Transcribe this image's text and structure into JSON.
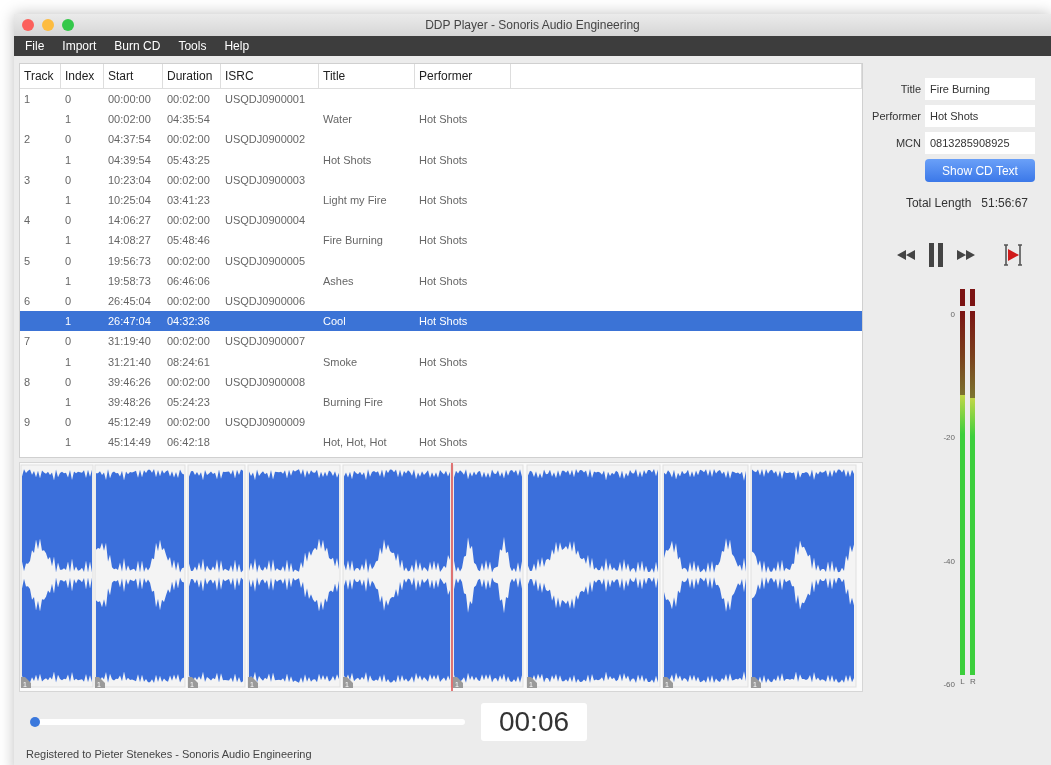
{
  "window": {
    "title": "DDP Player - Sonoris Audio Engineering"
  },
  "menu": [
    "File",
    "Import",
    "Burn CD",
    "Tools",
    "Help"
  ],
  "table": {
    "columns": [
      "Track",
      "Index",
      "Start",
      "Duration",
      "ISRC",
      "Title",
      "Performer"
    ],
    "rows": [
      {
        "track": "1",
        "index": "0",
        "start": "00:00:00",
        "duration": "00:02:00",
        "isrc": "USQDJ0900001",
        "selected": false
      },
      {
        "index": "1",
        "start": "00:02:00",
        "duration": "04:35:54",
        "title": "Water",
        "performer": "Hot Shots",
        "selected": false
      },
      {
        "track": "2",
        "index": "0",
        "start": "04:37:54",
        "duration": "00:02:00",
        "isrc": "USQDJ0900002",
        "selected": false
      },
      {
        "index": "1",
        "start": "04:39:54",
        "duration": "05:43:25",
        "title": "Hot Shots",
        "performer": "Hot Shots",
        "selected": false
      },
      {
        "track": "3",
        "index": "0",
        "start": "10:23:04",
        "duration": "00:02:00",
        "isrc": "USQDJ0900003",
        "selected": false
      },
      {
        "index": "1",
        "start": "10:25:04",
        "duration": "03:41:23",
        "title": "Light my Fire",
        "performer": "Hot Shots",
        "selected": false
      },
      {
        "track": "4",
        "index": "0",
        "start": "14:06:27",
        "duration": "00:02:00",
        "isrc": "USQDJ0900004",
        "selected": false
      },
      {
        "index": "1",
        "start": "14:08:27",
        "duration": "05:48:46",
        "title": "Fire Burning",
        "performer": "Hot Shots",
        "selected": false
      },
      {
        "track": "5",
        "index": "0",
        "start": "19:56:73",
        "duration": "00:02:00",
        "isrc": "USQDJ0900005",
        "selected": false
      },
      {
        "index": "1",
        "start": "19:58:73",
        "duration": "06:46:06",
        "title": "Ashes",
        "performer": "Hot Shots",
        "selected": false
      },
      {
        "track": "6",
        "index": "0",
        "start": "26:45:04",
        "duration": "00:02:00",
        "isrc": "USQDJ0900006",
        "selected": false
      },
      {
        "index": "1",
        "start": "26:47:04",
        "duration": "04:32:36",
        "title": "Cool",
        "performer": "Hot Shots",
        "selected": true
      },
      {
        "track": "7",
        "index": "0",
        "start": "31:19:40",
        "duration": "00:02:00",
        "isrc": "USQDJ0900007",
        "selected": false
      },
      {
        "index": "1",
        "start": "31:21:40",
        "duration": "08:24:61",
        "title": "Smoke",
        "performer": "Hot Shots",
        "selected": false
      },
      {
        "track": "8",
        "index": "0",
        "start": "39:46:26",
        "duration": "00:02:00",
        "isrc": "USQDJ0900008",
        "selected": false
      },
      {
        "index": "1",
        "start": "39:48:26",
        "duration": "05:24:23",
        "title": "Burning Fire",
        "performer": "Hot Shots",
        "selected": false
      },
      {
        "track": "9",
        "index": "0",
        "start": "45:12:49",
        "duration": "00:02:00",
        "isrc": "USQDJ0900009",
        "selected": false
      },
      {
        "index": "1",
        "start": "45:14:49",
        "duration": "06:42:18",
        "title": "Hot, Hot, Hot",
        "performer": "Hot Shots",
        "selected": false
      }
    ]
  },
  "waveform": {
    "index_markers": [
      "1",
      "1",
      "1",
      "1",
      "1",
      "1",
      "1",
      "1",
      "1"
    ]
  },
  "cd_text": {
    "fields": [
      {
        "label": "Title",
        "value": "Fire Burning"
      },
      {
        "label": "Performer",
        "value": "Hot Shots"
      },
      {
        "label": "MCN",
        "value": "0813285908925"
      }
    ],
    "button": "Show CD Text",
    "total_length_label": "Total Length",
    "total_length": "51:56:67"
  },
  "meter": {
    "ticks": [
      "0",
      "-20",
      "-40",
      "-60"
    ],
    "channels": [
      {
        "name": "L",
        "level": 0.77
      },
      {
        "name": "R",
        "level": 0.76
      }
    ]
  },
  "position": {
    "level": 0.01,
    "time": "00:06"
  },
  "status_bar": "Registered to Pieter Stenekes - Sonoris Audio Engineering"
}
